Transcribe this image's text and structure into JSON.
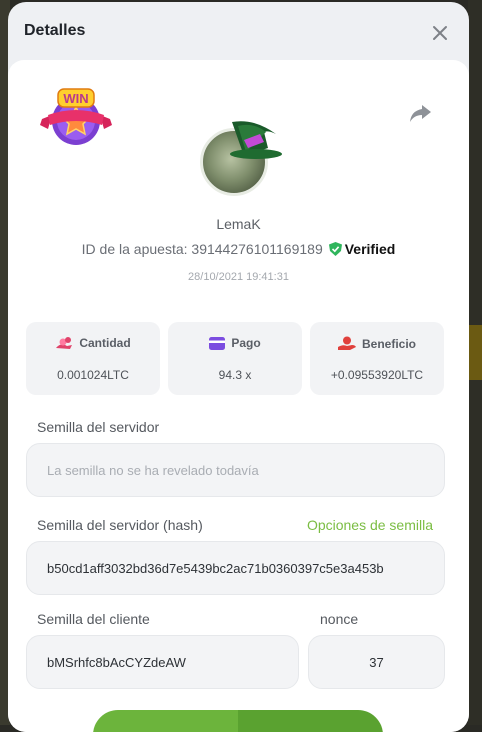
{
  "modal": {
    "title": "Detalles"
  },
  "player": {
    "username": "LemaK",
    "bet_id_label": "ID de la apuesta: 39144276101169189",
    "verified_label": "Verified",
    "timestamp": "28/10/2021 19:41:31"
  },
  "badge": {
    "text": "WIN"
  },
  "stats": [
    {
      "label": "Cantidad",
      "value": "0.001024LTC",
      "icon": "coin-stack-icon",
      "color": "#e0436a"
    },
    {
      "label": "Pago",
      "value": "94.3 x",
      "icon": "card-icon",
      "color": "#7b4ce0"
    },
    {
      "label": "Beneficio",
      "value": "+0.09553920LTC",
      "icon": "hand-coin-icon",
      "color": "#e0403c"
    }
  ],
  "server_seed": {
    "label": "Semilla del servidor",
    "placeholder": "La semilla no se ha revelado todavía"
  },
  "server_seed_hash": {
    "label": "Semilla del servidor (hash)",
    "options_link": "Opciones de semilla",
    "value": "b50cd1aff3032bd36d7e5439bc2ac71b0360397c5e3a453b"
  },
  "client_seed": {
    "label": "Semilla del cliente",
    "value": "bMSrhfc8bAcCYZdeAW"
  },
  "nonce": {
    "label": "nonce",
    "value": "37"
  },
  "colors": {
    "accent_green": "#7bbd43",
    "verified_green": "#2fb55c",
    "modal_bg": "#eef0f3"
  }
}
